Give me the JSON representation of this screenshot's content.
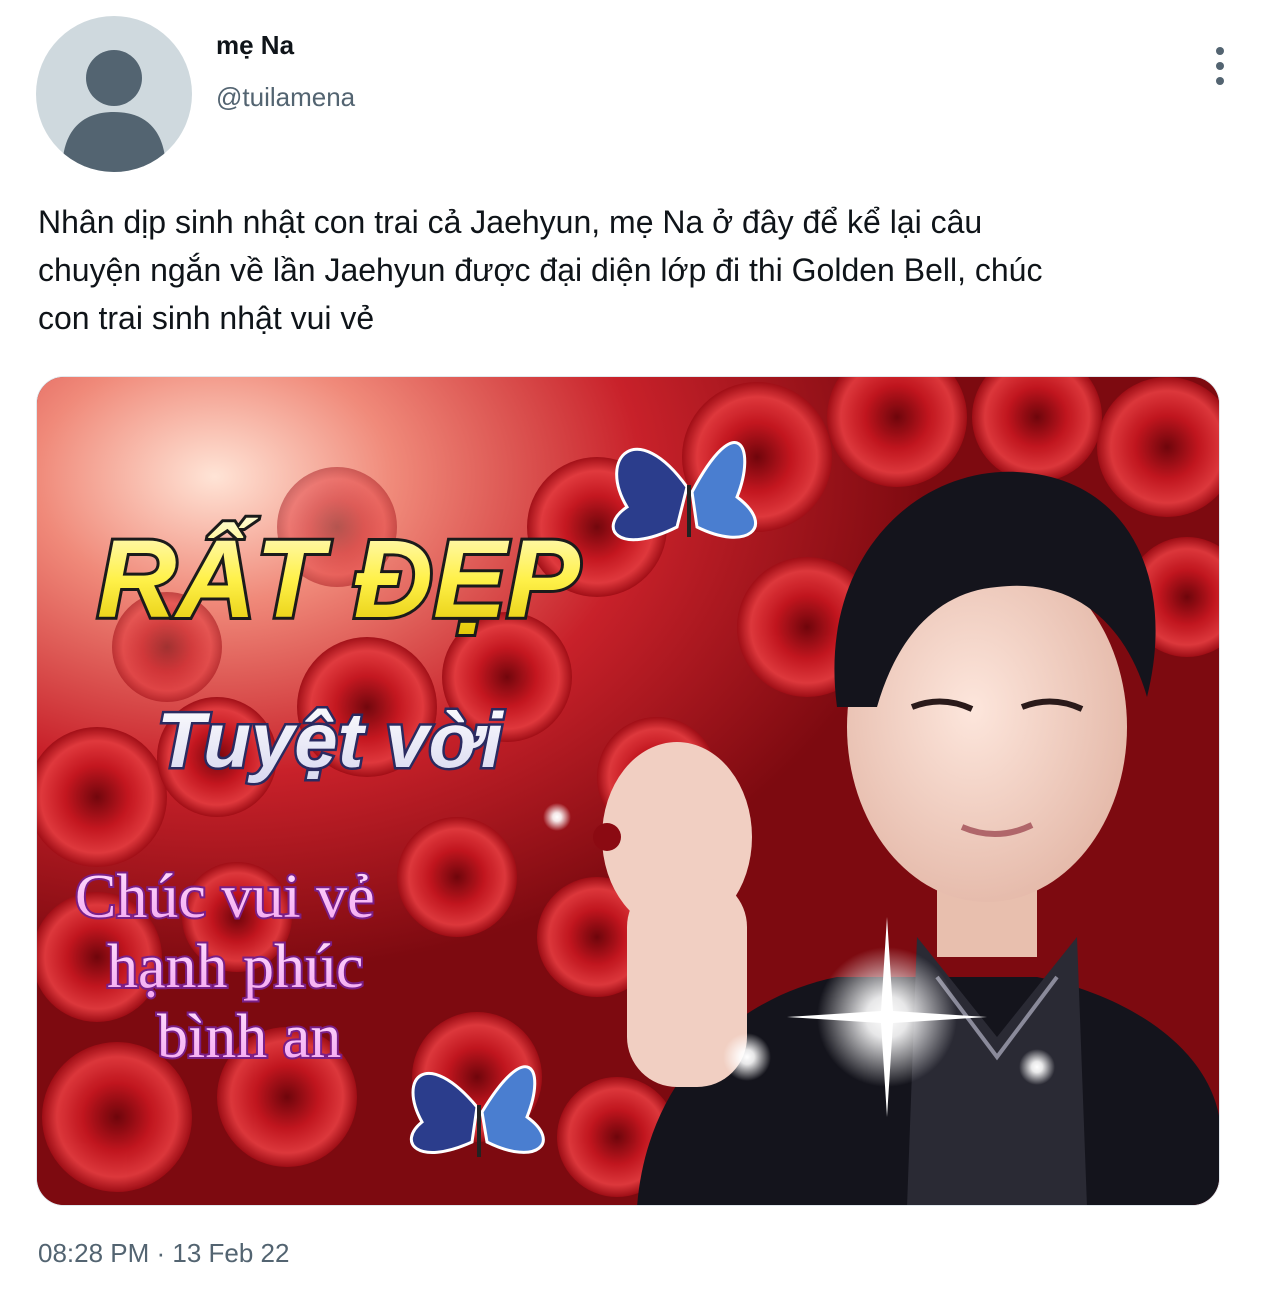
{
  "tweet": {
    "display_name": "mẹ Na",
    "handle": "@tuilamena",
    "text": "Nhân dịp sinh nhật con trai cả Jaehyun, mẹ Na ở đây để kể lại câu\nchuyện ngắn về lần Jaehyun được đại diện lớp đi thi Golden Bell, chúc\ncon trai sinh nhật vui vẻ",
    "timestamp": "08:28 PM · 13 Feb 22",
    "avatar_icon": "default-person-icon",
    "more_icon": "more-vertical-icon"
  },
  "media": {
    "line1": "RẤT ĐẸP",
    "line2": "Tuyệt vời",
    "line3": "Chúc vui vẻ",
    "line4": "hạnh phúc",
    "line5": "bình an"
  },
  "colors": {
    "text_primary": "#0f1419",
    "text_secondary": "#536471",
    "avatar_bg": "#cfd9de",
    "avatar_figure": "#536471"
  }
}
